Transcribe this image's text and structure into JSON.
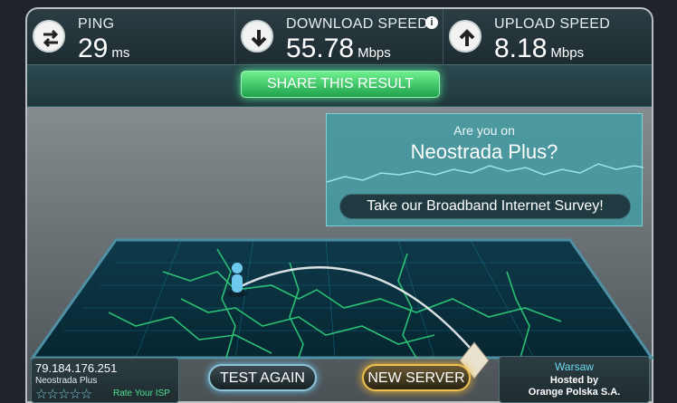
{
  "metrics": {
    "ping": {
      "label": "PING",
      "value": "29",
      "unit": "ms",
      "icon": "ping-icon"
    },
    "download": {
      "label": "DOWNLOAD SPEED",
      "value": "55.78",
      "unit": "Mbps",
      "icon": "download-arrow-icon",
      "info": "i"
    },
    "upload": {
      "label": "UPLOAD SPEED",
      "value": "8.18",
      "unit": "Mbps",
      "icon": "upload-arrow-icon"
    }
  },
  "share": {
    "label": "SHARE THIS RESULT"
  },
  "ad": {
    "line1": "Are you on",
    "line2": "Neostrada Plus?",
    "survey_label": "Take our Broadband Internet Survey!"
  },
  "isp": {
    "ip": "79.184.176.251",
    "name": "Neostrada Plus",
    "stars": "☆☆☆☆☆",
    "rate_label": "Rate Your ISP"
  },
  "buttons": {
    "test_again": "TEST AGAIN",
    "new_server": "NEW SERVER"
  },
  "server": {
    "city": "Warsaw",
    "hosted_by": "Hosted by",
    "host": "Orange Polska S.A."
  },
  "colors": {
    "accent_green": "#2ec866",
    "map_line": "#2fd07a",
    "grid": "#1d8fb3",
    "gold": "#f0c050"
  }
}
